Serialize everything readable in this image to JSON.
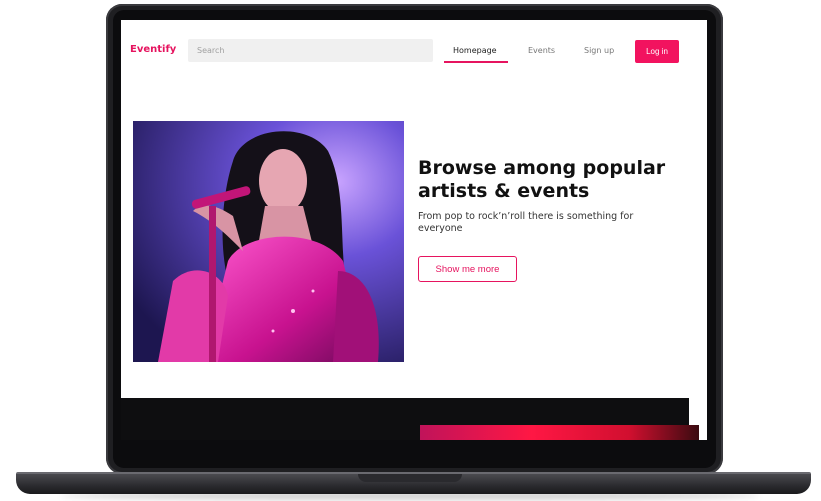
{
  "brand": {
    "name": "Eventify",
    "accent": "#e6145f"
  },
  "search": {
    "placeholder": "Search"
  },
  "nav": {
    "homepage": "Homepage",
    "events": "Events",
    "signup": "Sign up",
    "login": "Log in"
  },
  "hero": {
    "title": "Browse among popular artists & events",
    "subtitle": "From pop to rock’n’roll there is something for everyone",
    "cta": "Show me more"
  }
}
